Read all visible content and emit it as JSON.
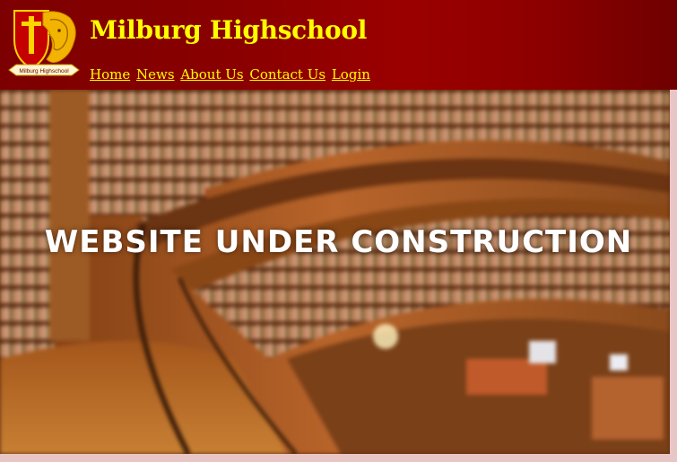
{
  "site": {
    "title": "Milburg Highschool",
    "logo_text": "Milburg Highschool"
  },
  "nav": {
    "items": [
      "Home",
      "News",
      "About Us",
      "Contact Us",
      "Login"
    ]
  },
  "hero": {
    "heading": "WEBSITE UNDER CONSTRUCTION"
  },
  "colors": {
    "header_bg": "#8a0000",
    "title_text": "#ffff00",
    "nav_link": "#ffff00",
    "page_bg": "#e9c6c6"
  },
  "icons": {
    "logo": "school-crest-lion-icon"
  }
}
